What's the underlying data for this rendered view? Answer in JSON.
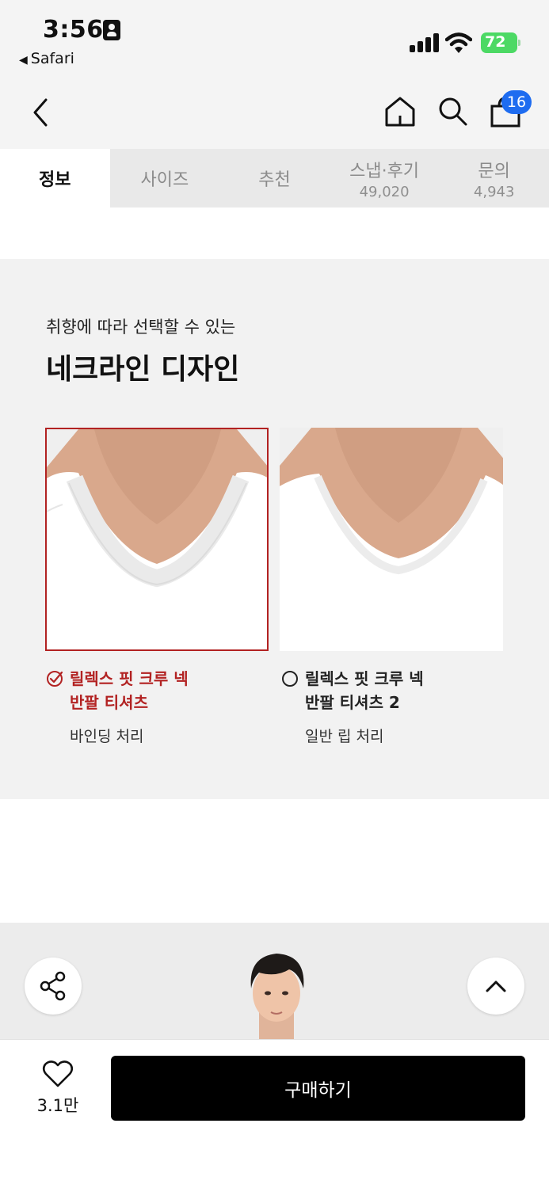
{
  "status_bar": {
    "time": "3:56",
    "back_app": "Safari",
    "battery": "72",
    "icons": [
      "person-id-icon",
      "signal-icon",
      "wifi-icon",
      "battery-icon"
    ]
  },
  "nav": {
    "cart_count": "16",
    "icons": [
      "back-arrow-icon",
      "home-icon",
      "search-icon",
      "shopping-bag-icon"
    ]
  },
  "tabs": [
    {
      "label": "정보",
      "count": ""
    },
    {
      "label": "사이즈",
      "count": ""
    },
    {
      "label": "추천",
      "count": ""
    },
    {
      "label": "스냅·후기",
      "count": "49,020"
    },
    {
      "label": "문의",
      "count": "4,943"
    }
  ],
  "section": {
    "subtitle": "취향에 따라 선택할 수 있는",
    "title": "네크라인 디자인",
    "options": [
      {
        "name_line1": "릴렉스 핏 크루 넥",
        "name_line2": "반팔 티셔츠",
        "desc": "바인딩 처리",
        "selected": true
      },
      {
        "name_line1": "릴렉스 핏 크루 넥",
        "name_line2": "반팔 티셔츠 2",
        "desc": "일반 립 처리",
        "selected": false
      }
    ]
  },
  "bottom": {
    "like_count": "3.1만",
    "buy_label": "구매하기"
  },
  "colors": {
    "accent_red": "#b22222",
    "badge_blue": "#1e6cf0",
    "buy_button": "#000000"
  }
}
